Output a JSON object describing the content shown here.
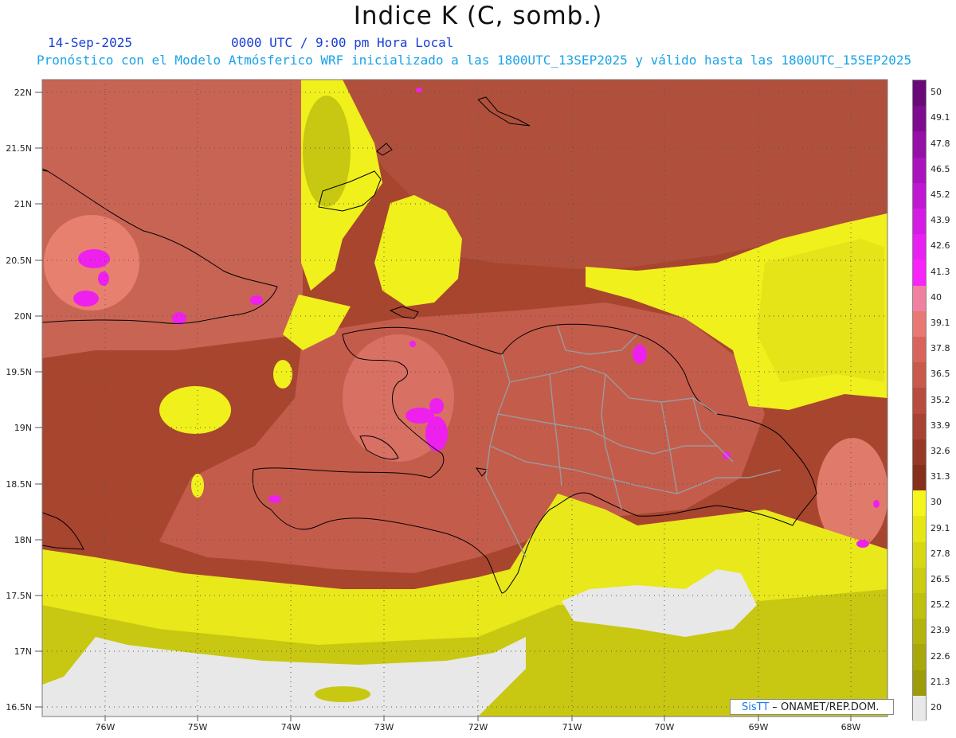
{
  "title": "Indice K (C, somb.)",
  "header": {
    "date": "14-Sep-2025",
    "time": "0000 UTC / 9:00 pm Hora Local",
    "model_line": "Pronóstico con el Modelo Atmósferico WRF inicializado a las 1800UTC_13SEP2025 y válido hasta las  1800UTC_15SEP2025"
  },
  "axes": {
    "lat_labels": [
      "22N",
      "21.5N",
      "21N",
      "20.5N",
      "20N",
      "19.5N",
      "19N",
      "18.5N",
      "18N",
      "17.5N",
      "17N",
      "16.5N"
    ],
    "lon_labels": [
      "76W",
      "75W",
      "74W",
      "73W",
      "72W",
      "71W",
      "70W",
      "69W",
      "68W"
    ]
  },
  "colorbar": {
    "labels": [
      "50",
      "49.1",
      "47.8",
      "46.5",
      "45.2",
      "43.9",
      "42.6",
      "41.3",
      "40",
      "39.1",
      "37.8",
      "36.5",
      "35.2",
      "33.9",
      "32.6",
      "31.3",
      "30",
      "29.1",
      "27.8",
      "26.5",
      "25.2",
      "23.9",
      "22.6",
      "21.3",
      "20"
    ],
    "colors": [
      "#6a0a78",
      "#7e0c8e",
      "#9410a6",
      "#aa14bc",
      "#c018d2",
      "#d41ce4",
      "#e820f2",
      "#f824fa",
      "#f080a0",
      "#e87874",
      "#d8645c",
      "#c85a4c",
      "#b84c3e",
      "#a84232",
      "#983826",
      "#86301c",
      "#f5f51c",
      "#e6e614",
      "#d8d812",
      "#cccc10",
      "#c0c00e",
      "#b4b40c",
      "#a8a80a",
      "#9c9c08",
      "#e8e8e8"
    ]
  },
  "credit": {
    "brand": "SisTT",
    "text": " – ONAMET/REP.DOM."
  }
}
